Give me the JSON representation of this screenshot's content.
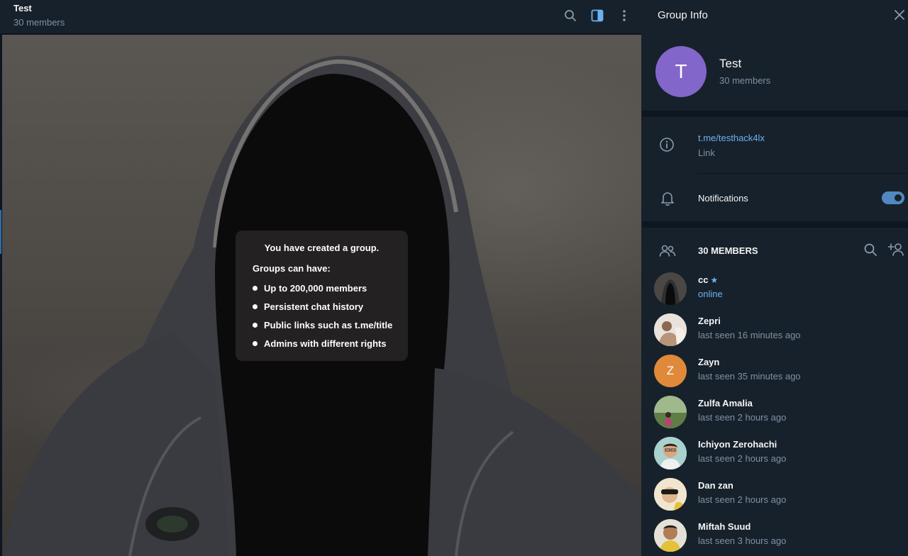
{
  "chat": {
    "title": "Test",
    "subtitle": "30 members",
    "bubble": {
      "title": "You have created a group.",
      "subtitle": "Groups can have:",
      "items": [
        "Up to 200,000 members",
        "Persistent chat history",
        "Public links such as t.me/title",
        "Admins with different rights"
      ]
    }
  },
  "panel": {
    "title": "Group Info",
    "avatar_letter": "T",
    "group_name": "Test",
    "group_members": "30 members",
    "link": "t.me/testhack4lx",
    "link_label": "Link",
    "notifications_label": "Notifications",
    "notifications_on": true,
    "members_heading": "30 MEMBERS",
    "members": [
      {
        "name": "cc",
        "status": "online",
        "avatar": "photo-dark",
        "starred": true
      },
      {
        "name": "Zepri",
        "status": "last seen 16 minutes ago",
        "avatar": "photo-light"
      },
      {
        "name": "Zayn",
        "status": "last seen 35 minutes ago",
        "avatar": "Z",
        "color": "#e0893a"
      },
      {
        "name": "Zulfa Amalia",
        "status": "last seen 2 hours ago",
        "avatar": "photo-green"
      },
      {
        "name": "Ichiyon Zerohachi",
        "status": "last seen 2 hours ago",
        "avatar": "photo-face"
      },
      {
        "name": "Dan zan",
        "status": "last seen 2 hours ago",
        "avatar": "photo-yellow"
      },
      {
        "name": "Miftah Suud",
        "status": "last seen 3 hours ago",
        "avatar": "photo-face2"
      }
    ]
  },
  "colors": {
    "accent": "#6ab3f3",
    "panel_bg": "#17212b",
    "page_bg": "#0e1621",
    "toggle": "#5288c1",
    "group_avatar": "#8366c9"
  }
}
